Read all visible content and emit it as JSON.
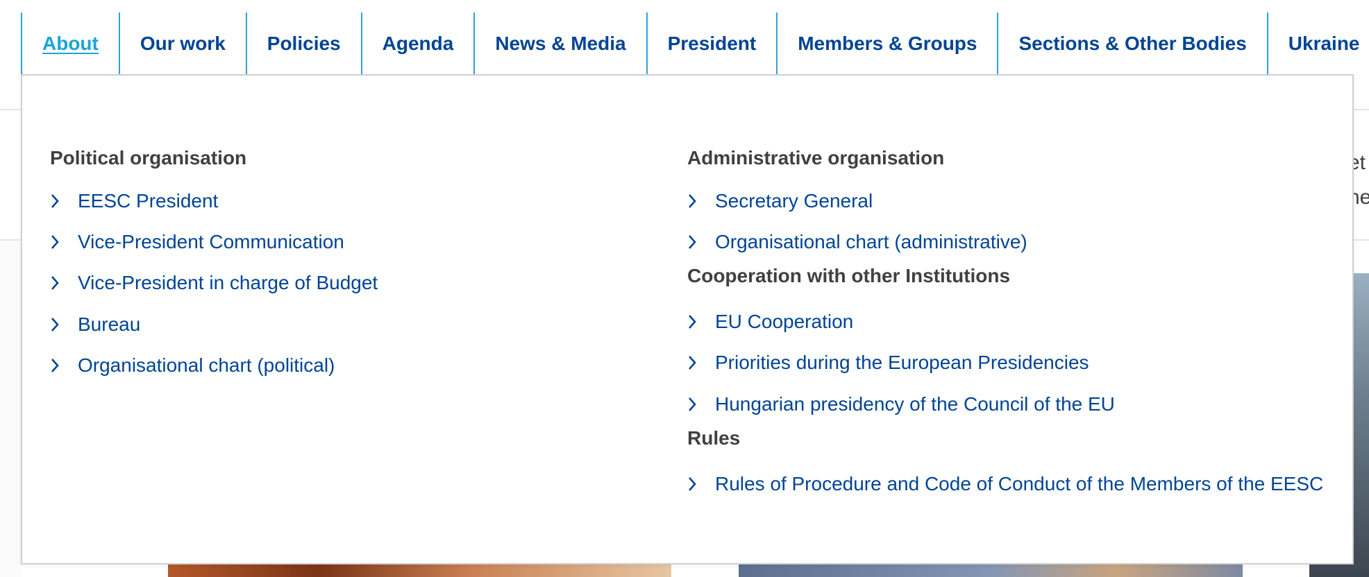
{
  "nav": {
    "items": [
      {
        "label": "About",
        "active": true
      },
      {
        "label": "Our work"
      },
      {
        "label": "Policies"
      },
      {
        "label": "Agenda"
      },
      {
        "label": "News & Media"
      },
      {
        "label": "President"
      },
      {
        "label": "Members & Groups"
      },
      {
        "label": "Sections & Other Bodies"
      },
      {
        "label": "Ukraine"
      }
    ]
  },
  "menu": {
    "political": {
      "title": "Political organisation",
      "links": [
        "EESC President",
        "Vice-President Communication",
        "Vice-President in charge of Budget",
        "Bureau",
        "Organisational chart (political)"
      ]
    },
    "administrative": {
      "title": "Administrative organisation",
      "links": [
        "Secretary General",
        "Organisational chart (administrative)"
      ]
    },
    "cooperation": {
      "title": "Cooperation with other Institutions",
      "links": [
        "EU Cooperation",
        "Priorities during the European Presidencies",
        "Hungarian presidency of the Council of the EU"
      ]
    },
    "rules": {
      "title": "Rules",
      "links": [
        "Rules of Procedure and Code of Conduct of the Members of the EESC"
      ]
    }
  },
  "background": {
    "snippet_1": "et",
    "snippet_2": "he"
  },
  "colors": {
    "link": "#004494",
    "active": "#1aa4d8",
    "nav_border": "#2aa6d8",
    "heading": "#404040"
  },
  "icons": {
    "link_bullet": "chevron-right-icon"
  }
}
